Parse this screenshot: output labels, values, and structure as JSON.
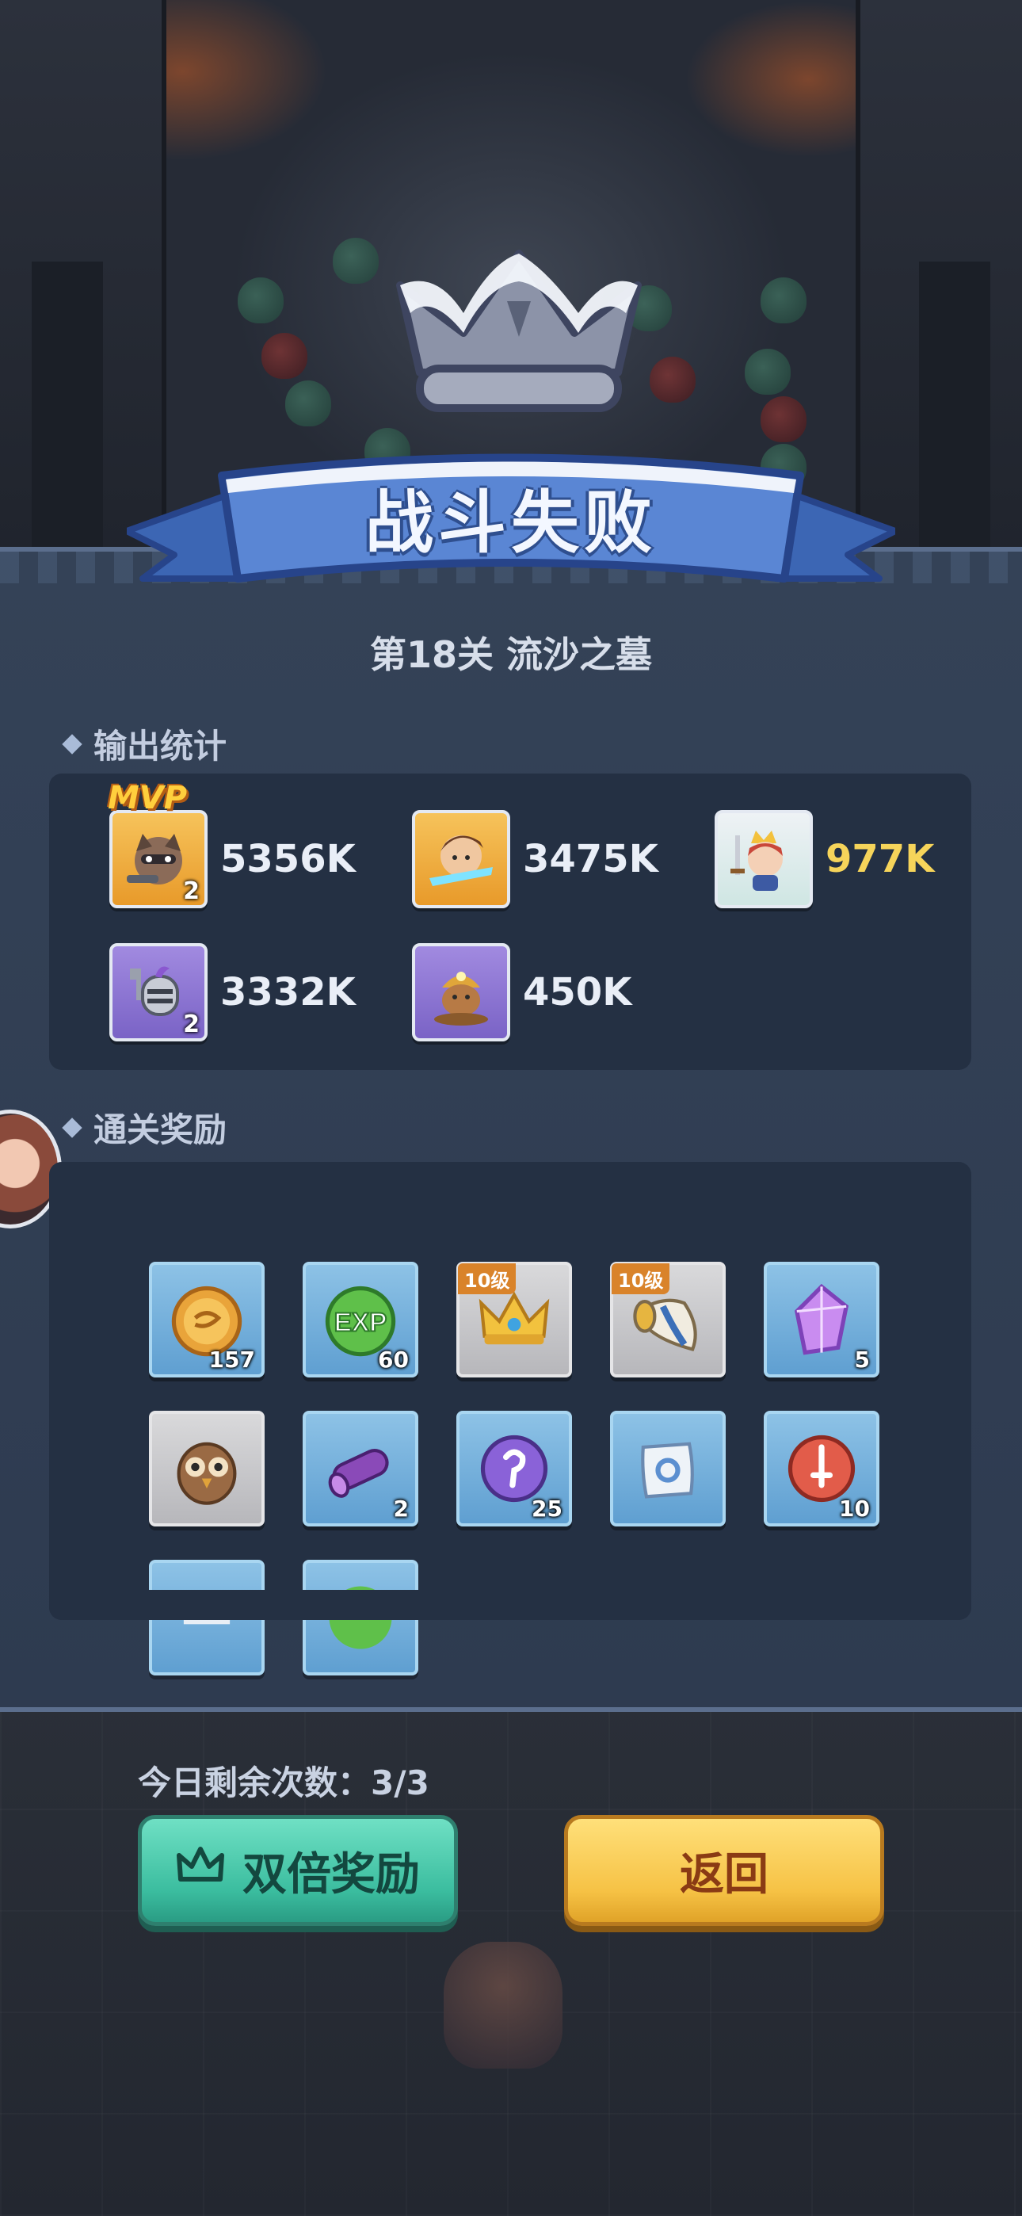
{
  "result_banner": {
    "title": "战斗失败"
  },
  "stage": {
    "title": "第18关 流沙之墓"
  },
  "damage_stats": {
    "section_label": "输出统计",
    "mvp_label": "MVP",
    "heroes": [
      {
        "hero": "raccoon-gunner",
        "frame": "gold",
        "level": "2",
        "damage": "5356K",
        "mvp": true,
        "highlight": false
      },
      {
        "hero": "wind-warrior",
        "frame": "gold",
        "level": "",
        "damage": "3475K",
        "mvp": false,
        "highlight": false
      },
      {
        "hero": "little-king",
        "frame": "white",
        "level": "",
        "damage": "977K",
        "mvp": false,
        "highlight": true
      },
      {
        "hero": "armored-knight",
        "frame": "purple",
        "level": "2",
        "damage": "3332K",
        "mvp": false,
        "highlight": false
      },
      {
        "hero": "miner-mole",
        "frame": "purple",
        "level": "",
        "damage": "450K",
        "mvp": false,
        "highlight": false
      }
    ]
  },
  "rewards": {
    "section_label": "通关奖励",
    "items": [
      {
        "icon": "gold-coin-icon",
        "tile": "blue",
        "count": "157",
        "tag": ""
      },
      {
        "icon": "exp-orb-icon",
        "tile": "blue",
        "count": "60",
        "tag": ""
      },
      {
        "icon": "crown-icon",
        "tile": "grey",
        "count": "",
        "tag": "10级"
      },
      {
        "icon": "horn-icon",
        "tile": "grey",
        "count": "",
        "tag": "10级"
      },
      {
        "icon": "purple-crystal-icon",
        "tile": "blue",
        "count": "5",
        "tag": ""
      },
      {
        "icon": "owl-icon",
        "tile": "grey",
        "count": "",
        "tag": ""
      },
      {
        "icon": "purple-log-icon",
        "tile": "blue",
        "count": "2",
        "tag": ""
      },
      {
        "icon": "purple-rune-icon",
        "tile": "blue",
        "count": "25",
        "tag": ""
      },
      {
        "icon": "scroll-icon",
        "tile": "blue",
        "count": "",
        "tag": ""
      },
      {
        "icon": "red-sword-orb-icon",
        "tile": "blue",
        "count": "10",
        "tag": ""
      },
      {
        "icon": "paper-icon",
        "tile": "blue",
        "count": "",
        "tag": ""
      },
      {
        "icon": "green-orb-icon",
        "tile": "blue",
        "count": "",
        "tag": ""
      }
    ]
  },
  "footer": {
    "remaining_attempts": "今日剩余次数：3/3",
    "double_reward_label": "双倍奖励",
    "return_label": "返回"
  },
  "colors": {
    "panel": "#2e3b50",
    "box": "#243043",
    "highlight_damage": "#f6d45a",
    "green_button": "#3bbd9f",
    "yellow_button": "#f6c245"
  }
}
